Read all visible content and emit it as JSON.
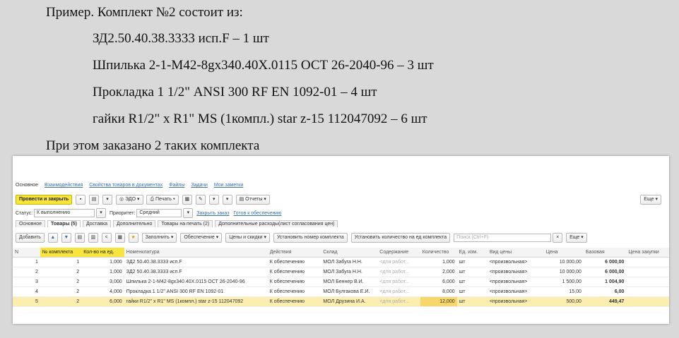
{
  "document": {
    "heading": "Пример. Комплект №2 состоит из:",
    "items": [
      "ЗД2.50.40.38.3333 исп.F – 1 шт",
      "Шпилька 2-1-М42-8gx340.40Х.0115 ОСТ 26-2040-96 – 3 шт",
      "Прокладка 1 1/2\" ANSI 300 RF EN 1092-01 – 4 шт",
      "гайки R1/2\" x R1\" MS (1компл.) star z-15 112047092 – 6 шт"
    ],
    "footer": "При этом заказано 2 таких комплекта"
  },
  "nav": {
    "tabs": [
      "Основное",
      "Взаимодействия",
      "Свойства товаров в документах",
      "Файлы",
      "Задачи",
      "Мои заметки"
    ]
  },
  "toolbar": {
    "post_close": "Провести и закрыть",
    "edo": "ЭДО",
    "print": "Печать",
    "reports": "Отчеты",
    "more": "Еще"
  },
  "status_bar": {
    "status_label": "Статус:",
    "status_value": "К выполнению",
    "priority_label": "Приоритет:",
    "priority_value": "Средний",
    "close_order_link": "Закрыть заказ",
    "ready_link": "Готов к обеспечению"
  },
  "form_tabs": [
    "Основное",
    "Товары (5)",
    "Доставка",
    "Дополнительно",
    "Товары на печать (2)",
    "Дополнительные расходы(лист согласования цен)"
  ],
  "table_toolbar": {
    "add": "Добавить",
    "fill": "Заполнить",
    "supply": "Обеспечение",
    "prices": "Цены и скидки",
    "set_kit_number": "Установить номер комплекта",
    "set_qty_per_kit": "Установить количество на ед комплекта",
    "search_placeholder": "Поиск (Ctrl+F)",
    "clear": "×",
    "more": "Еще"
  },
  "table": {
    "columns": [
      "N",
      "№ комплекта",
      "Кол-во на ед.",
      "Номенклатура",
      "Действия",
      "Склад",
      "Содержание",
      "Количество",
      "Ед. изм.",
      "Вид цены",
      "Цена",
      "Базовая",
      "Цена закупки"
    ],
    "rows": [
      {
        "n": "1",
        "kit": "1",
        "per_unit": "1,000",
        "item": "ЗД2 50.40.38.3333 исп.F",
        "action": "К обеспечению",
        "warehouse": "МОЛ Забуга Н.Н.",
        "content": "<для работ...",
        "qty": "1,000",
        "unit": "шт",
        "price_type": "<произвольная>",
        "price": "10 000,00",
        "base": "6 000,00",
        "purchase": ""
      },
      {
        "n": "2",
        "kit": "2",
        "per_unit": "1,000",
        "item": "ЗД2 50.40.38.3333 исп.F",
        "action": "К обеспечению",
        "warehouse": "МОЛ Забуга Н.Н.",
        "content": "<для работ...",
        "qty": "2,000",
        "unit": "шт",
        "price_type": "<произвольная>",
        "price": "10 000,00",
        "base": "6 000,00",
        "purchase": ""
      },
      {
        "n": "3",
        "kit": "2",
        "per_unit": "3,000",
        "item": "Шпилька 2-1-М42-8gx340.40Х.0115 ОСТ 26-2040-96",
        "action": "К обеспечению",
        "warehouse": "МОЛ Беннер В.И.",
        "content": "<для работ...",
        "qty": "6,000",
        "unit": "шт",
        "price_type": "<произвольная>",
        "price": "1 500,00",
        "base": "1 004,90",
        "purchase": ""
      },
      {
        "n": "4",
        "kit": "2",
        "per_unit": "4,000",
        "item": "Прокладка 1 1/2\" ANSI 300 RF EN 1092-01",
        "action": "К обеспечению",
        "warehouse": "МОЛ Булгакова Е.И.",
        "content": "<для работ...",
        "qty": "8,000",
        "unit": "шт",
        "price_type": "<произвольная>",
        "price": "15,00",
        "base": "6,00",
        "purchase": ""
      },
      {
        "n": "5",
        "kit": "2",
        "per_unit": "6,000",
        "item": "гайки R1/2\" x R1\" MS (1компл.) star z-15 112047092",
        "action": "К обеспечению",
        "warehouse": "МОЛ Друзина И.А.",
        "content": "<для работ...",
        "qty": "12,000",
        "unit": "шт",
        "price_type": "<произвольная>",
        "price": "500,00",
        "base": "449,47",
        "purchase": ""
      }
    ]
  },
  "colors": {
    "highlight": "#f7e43c",
    "link": "#3a6fb0",
    "selected_row": "#fbeeb0"
  }
}
